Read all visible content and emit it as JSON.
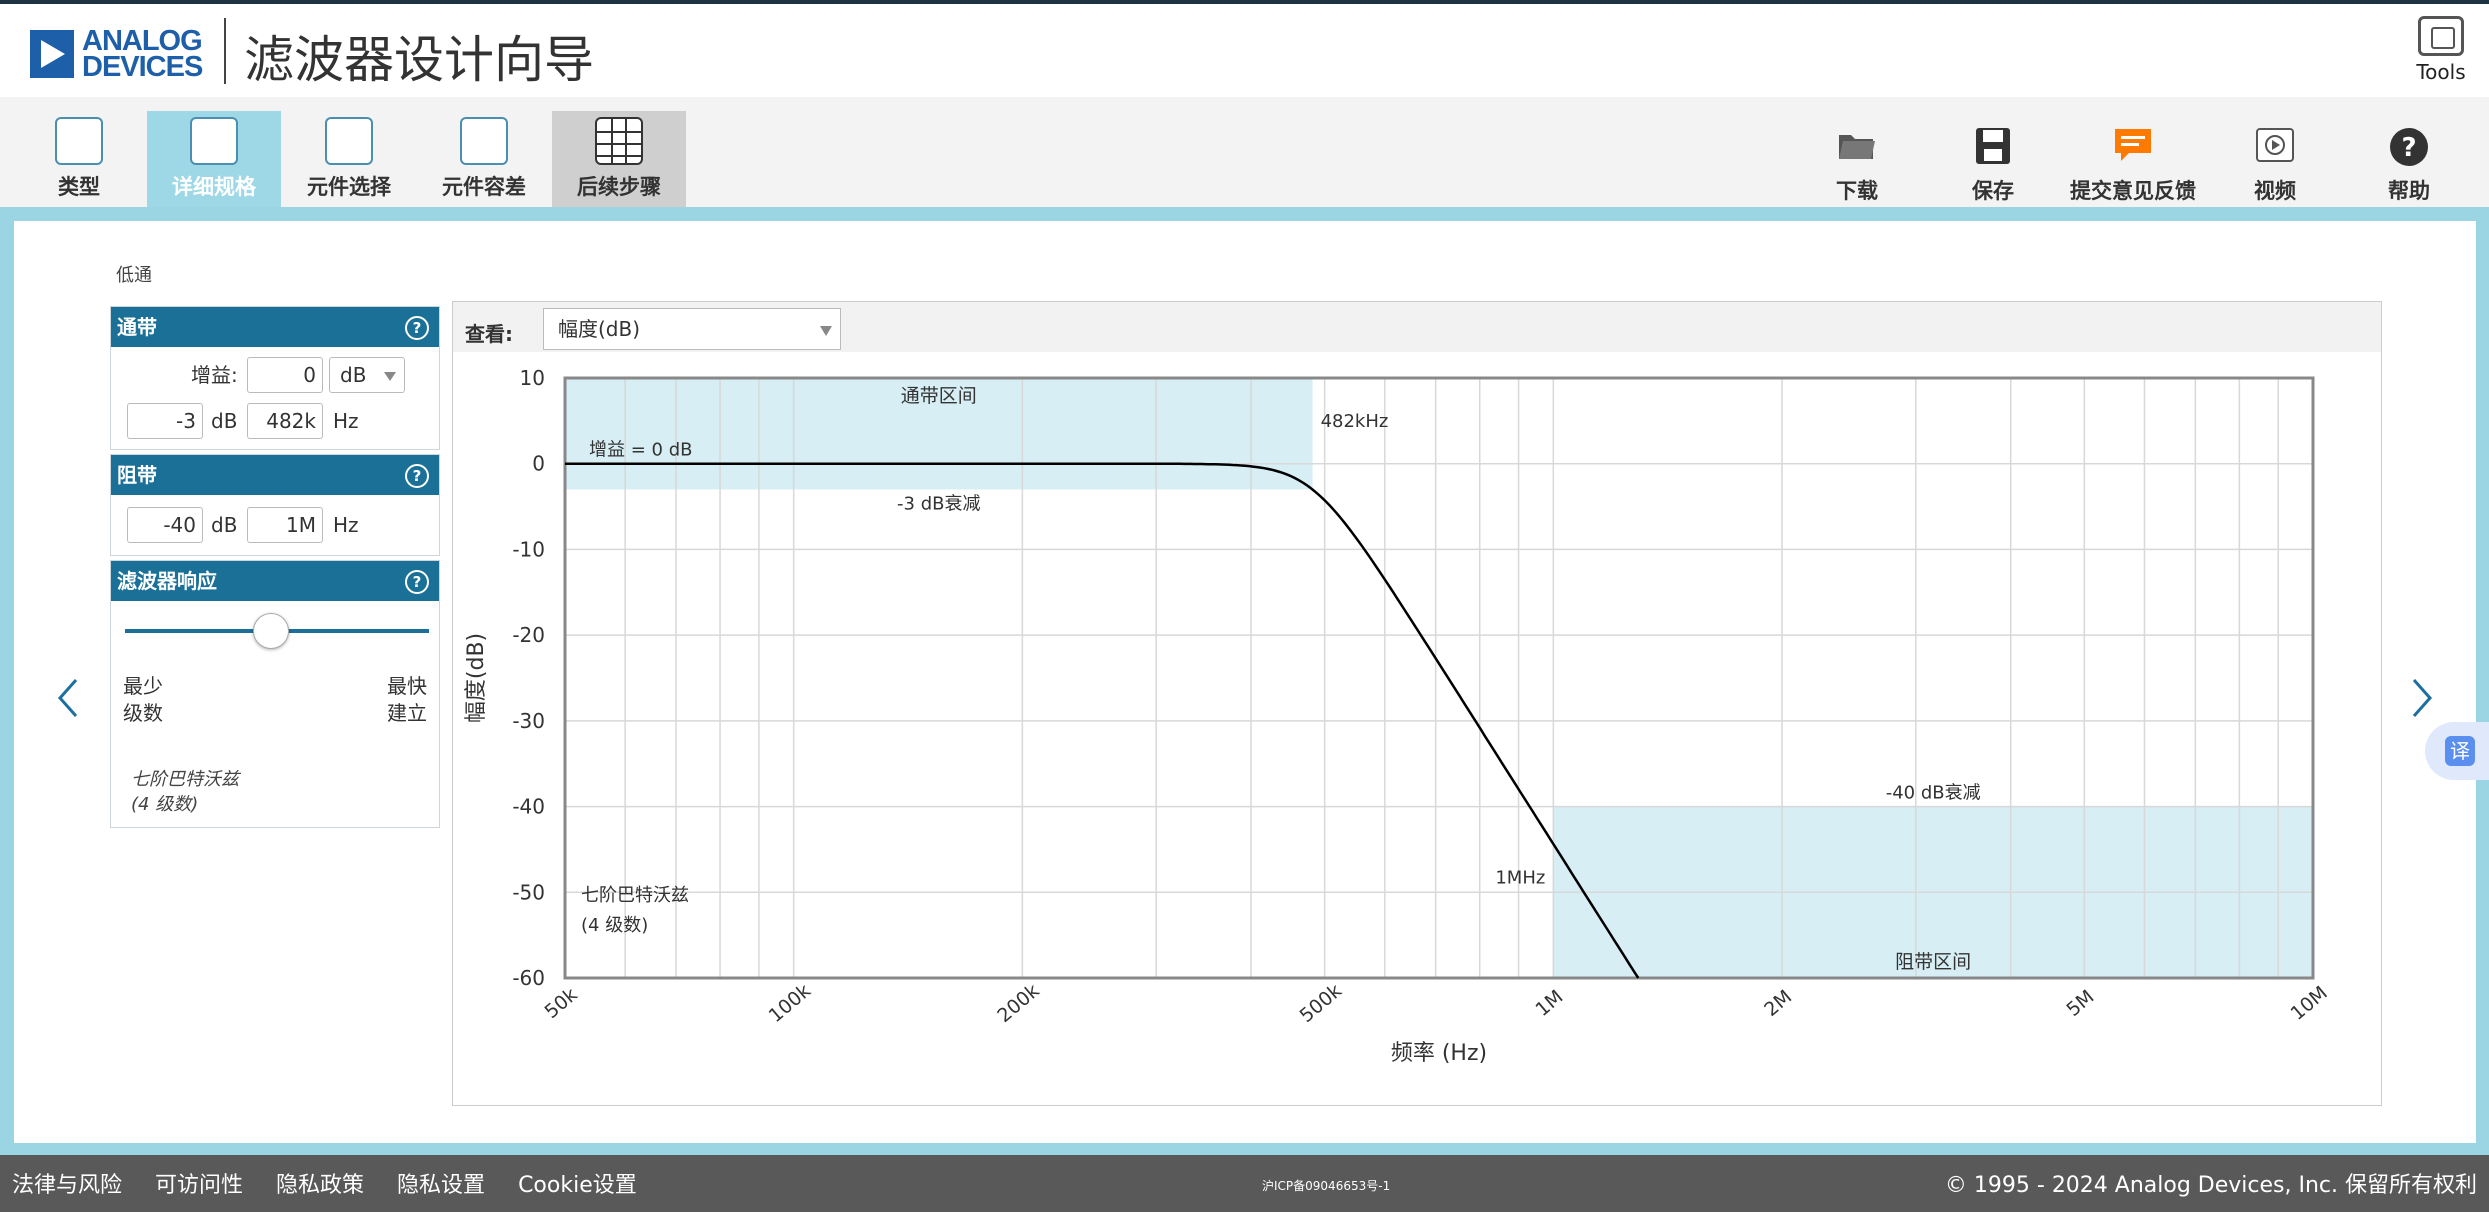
{
  "app": {
    "brand_line1": "ANALOG",
    "brand_line2": "DEVICES",
    "title": "滤波器设计向导",
    "tools_label": "Tools"
  },
  "toolbar": {
    "left": [
      {
        "label": "类型",
        "icon": "filter-type-icon"
      },
      {
        "label": "详细规格",
        "icon": "specifications-icon",
        "active": true
      },
      {
        "label": "元件选择",
        "icon": "component-selection-icon"
      },
      {
        "label": "元件容差",
        "icon": "component-tolerance-icon"
      },
      {
        "label": "后续步骤",
        "icon": "next-steps-icon"
      }
    ],
    "right": [
      {
        "label": "下载",
        "icon": "folder-icon"
      },
      {
        "label": "保存",
        "icon": "floppy-disk-icon"
      },
      {
        "label": "提交意见反馈",
        "icon": "feedback-icon"
      },
      {
        "label": "视频",
        "icon": "video-icon"
      },
      {
        "label": "帮助",
        "icon": "help-icon"
      }
    ]
  },
  "page": {
    "filter_kind": "低通"
  },
  "passband": {
    "title": "通带",
    "gain_label": "增益:",
    "gain_value": "0",
    "gain_unit": "dB",
    "atten_value": "-3",
    "atten_unit": "dB",
    "freq_value": "482k",
    "freq_unit": "Hz"
  },
  "stopband": {
    "title": "阻带",
    "atten_value": "-40",
    "atten_unit": "dB",
    "freq_value": "1M",
    "freq_unit": "Hz"
  },
  "response": {
    "title": "滤波器响应",
    "slider_position": 0.5,
    "left_line1": "最少",
    "left_line2": "级数",
    "right_line1": "最快",
    "right_line2": "建立",
    "summary_line1": "七阶巴特沃兹",
    "summary_line2": "(4 级数)"
  },
  "view": {
    "label": "查看:",
    "selected": "幅度(dB)"
  },
  "chart_data": {
    "type": "line",
    "xscale": "log",
    "xlim": [
      50000,
      10000000
    ],
    "ylim": [
      -60,
      10
    ],
    "xlabel": "频率 (Hz)",
    "ylabel": "幅度(dB)",
    "xticks": [
      {
        "v": 50000,
        "label": "50k"
      },
      {
        "v": 100000,
        "label": "100k"
      },
      {
        "v": 200000,
        "label": "200k"
      },
      {
        "v": 500000,
        "label": "500k"
      },
      {
        "v": 1000000,
        "label": "1M"
      },
      {
        "v": 2000000,
        "label": "2M"
      },
      {
        "v": 5000000,
        "label": "5M"
      },
      {
        "v": 10000000,
        "label": "10M"
      }
    ],
    "yticks": [
      10,
      0,
      -10,
      -20,
      -30,
      -40,
      -50,
      -60
    ],
    "response": {
      "order": 7,
      "cutoff_hz": 482000
    },
    "passband_region": {
      "x": [
        50000,
        482000
      ],
      "y": [
        -3,
        10
      ],
      "label": "通带区间"
    },
    "stopband_region": {
      "x": [
        1000000,
        10000000
      ],
      "y": [
        -60,
        -40
      ],
      "label": "阻带区间"
    },
    "annotations": {
      "gain": "增益 = 0 dB",
      "pass_atten": "-3 dB衰减",
      "pass_freq": "482kHz",
      "stop_atten": "-40 dB衰减",
      "stop_freq": "1MHz",
      "order_line1": "七阶巴特沃兹",
      "order_line2": "(4 级数)"
    },
    "colors": {
      "region": "#d6eef4",
      "curve": "#000000"
    }
  },
  "footer": {
    "links": [
      "法律与风险",
      "可访问性",
      "隐私政策",
      "隐私设置",
      "Cookie设置"
    ],
    "icp": "沪ICP备09046653号-1",
    "copyright": "© 1995 - 2024 Analog Devices, Inc. 保留所有权利"
  },
  "translate_label": "译",
  "colors": {
    "brand": "#1d5fa8",
    "section_header": "#1b7098",
    "frame": "#9bd4e3",
    "active_tab": "#9ed8e6",
    "feedback_icon": "#ff7a00"
  }
}
